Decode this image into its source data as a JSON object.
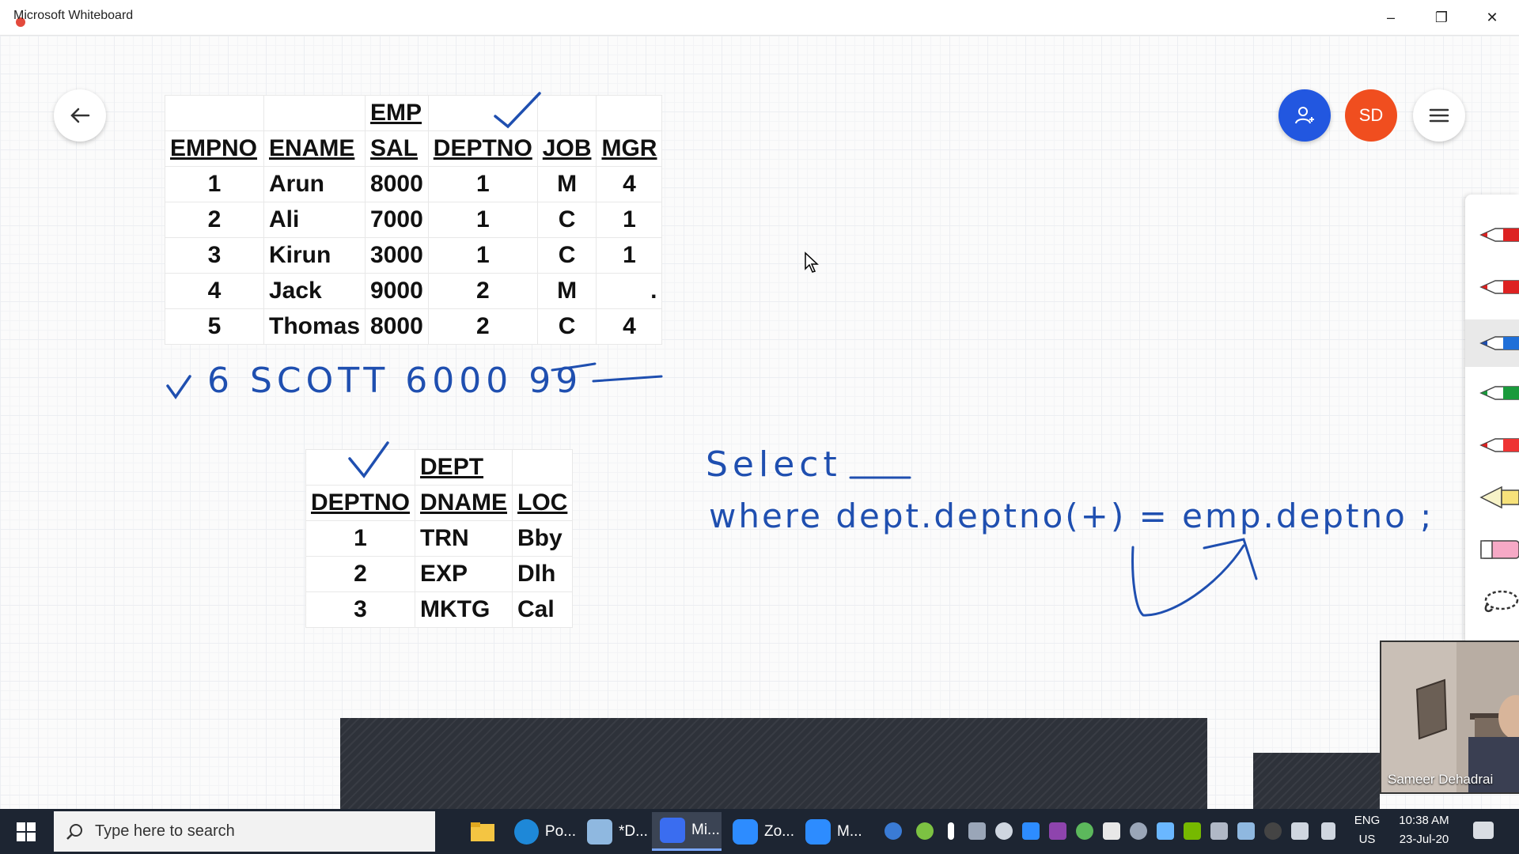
{
  "window": {
    "title": "Microsoft Whiteboard",
    "buttons": {
      "minimize": "–",
      "restore": "❐",
      "close": "✕"
    }
  },
  "header": {
    "avatar_initials": "SD"
  },
  "emp_table": {
    "title": "EMP",
    "columns": [
      "EMPNO",
      "ENAME",
      "SAL",
      "DEPTNO",
      "JOB",
      "MGR"
    ],
    "rows": [
      [
        "1",
        "Arun",
        "8000",
        "1",
        "M",
        "4"
      ],
      [
        "2",
        "Ali",
        "7000",
        "1",
        "C",
        "1"
      ],
      [
        "3",
        "Kirun",
        "3000",
        "1",
        "C",
        "1"
      ],
      [
        "4",
        "Jack",
        "9000",
        "2",
        "M",
        "."
      ],
      [
        "5",
        "Thomas",
        "8000",
        "2",
        "C",
        "4"
      ]
    ]
  },
  "dept_table": {
    "title": "DEPT",
    "columns": [
      "DEPTNO",
      "DNAME",
      "LOC"
    ],
    "rows": [
      [
        "1",
        "TRN",
        "Bby"
      ],
      [
        "2",
        "EXP",
        "Dlh"
      ],
      [
        "3",
        "MKTG",
        "Cal"
      ]
    ]
  },
  "ink": {
    "new_row": "6  SCOTT  6000  99",
    "select_line": "Select",
    "where_line": "where dept.deptno(+) = emp.deptno ;"
  },
  "video": {
    "participant_name": "Sameer Dehadrai"
  },
  "taskbar": {
    "search_placeholder": "Type here to search",
    "apps": [
      {
        "label": "Po...",
        "color": "#1e88d8"
      },
      {
        "label": "*D...",
        "color": "#8fb8e0"
      },
      {
        "label": "Mi...",
        "color": "#3a6df0"
      },
      {
        "label": "Zo...",
        "color": "#2d8cff"
      },
      {
        "label": "M...",
        "color": "#2d8cff"
      }
    ],
    "language": "ENG",
    "region": "US",
    "time": "10:38 AM",
    "date": "23-Jul-20"
  }
}
